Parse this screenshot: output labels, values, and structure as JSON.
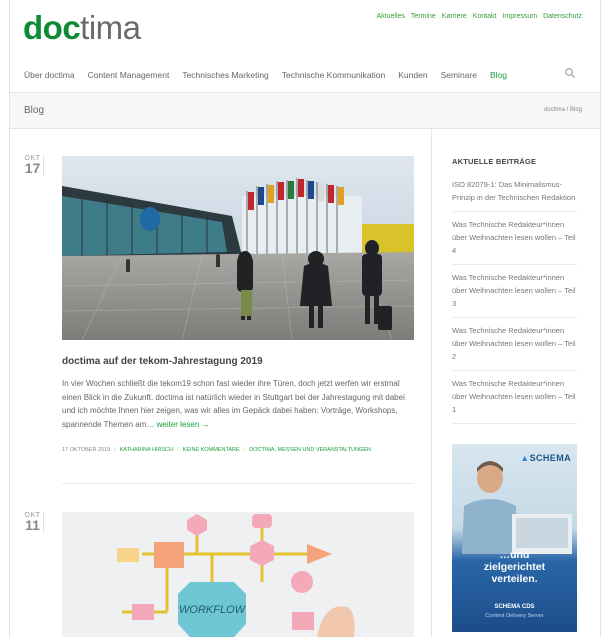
{
  "logo": {
    "part1": "doc",
    "part2": "tima"
  },
  "top_links": [
    "Aktuelles",
    "Termine",
    "Karriere",
    "Kontakt",
    "Impressum",
    "Datenschutz"
  ],
  "main_nav": [
    {
      "label": "Über doctima",
      "active": false
    },
    {
      "label": "Content Management",
      "active": false
    },
    {
      "label": "Technisches Marketing",
      "active": false
    },
    {
      "label": "Technische Kommunikation",
      "active": false
    },
    {
      "label": "Kunden",
      "active": false
    },
    {
      "label": "Seminare",
      "active": false
    },
    {
      "label": "Blog",
      "active": true
    }
  ],
  "page": {
    "title": "Blog",
    "breadcrumb": "doctima / Blog"
  },
  "posts": [
    {
      "month": "OKT",
      "day": "17",
      "title": "doctima auf der tekom-Jahrestagung 2019",
      "excerpt": "In vier Wochen schließt die tekom19 schon fast wieder ihre Türen, doch jetzt werfen wir erstmal einen Blick in die Zukunft. doctima ist natürlich wieder in Stuttgart bei der Jahrestagung mit dabei und ich möchte Ihnen hier zeigen, was wir alles im Gepäck dabei haben: Vorträge, Workshops, spannende Themen am…",
      "read_more": "weiter lesen →",
      "date": "17 OKTOBER 2019",
      "author": "KATHARINA HIRSCH",
      "comments": "KEINE KOMMENTARE",
      "categories": "DOCTIMA, MESSEN UND VERANSTALTUNGEN"
    },
    {
      "month": "OKT",
      "day": "11",
      "image_label": "WORKFLOW"
    }
  ],
  "sidebar": {
    "heading": "AKTUELLE BEITRÄGE",
    "items": [
      "ISO 82079-1: Das Minimalismus-Prinzip in der Technischen Redaktion",
      "Was Technische Redakteur*innen über Weihnachten lesen wollen – Teil 4",
      "Was Technische Redakteur*innen über Weihnachten lesen wollen – Teil 3",
      "Was Technische Redakteur*innen über Weihnachten lesen wollen – Teil 2",
      "Was Technische Redakteur*innen über Weihnachten lesen wollen – Teil 1"
    ]
  },
  "ad": {
    "brand": "SCHEMA",
    "headline_1": "…und",
    "headline_2": "zielgerichtet",
    "headline_3": "verteilen.",
    "product": "SCHEMA CDS",
    "product_sub": "Content Delivery Server"
  },
  "colors": {
    "brand_green": "#0c8a34",
    "link_green": "#19a23a",
    "text_gray": "#666666"
  }
}
